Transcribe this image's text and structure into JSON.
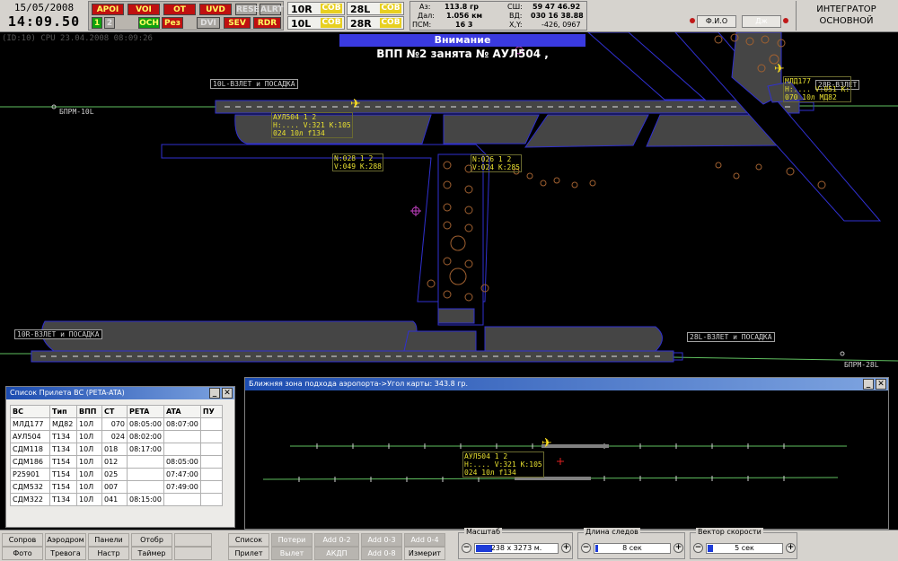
{
  "header": {
    "date": "15/05/2008",
    "time": "14:09.50",
    "cpu_line": "(ID:10) CPU 23.04.2008 08:09:26",
    "mode_buttons": [
      "APOI",
      "VOI",
      "OT",
      "UVD",
      "RESEZ",
      "ALRT",
      "1",
      "2",
      "OCH",
      "Рез",
      "DVI",
      "SEV",
      "RDR"
    ],
    "runway_status": [
      {
        "name": "10R",
        "state": "COB"
      },
      {
        "name": "10L",
        "state": "COB"
      },
      {
        "name": "28L",
        "state": "COB"
      },
      {
        "name": "28R",
        "state": "COB"
      }
    ],
    "info": {
      "az_label": "Аз:",
      "az_value": "113.8 гр",
      "dal_label": "Дал:",
      "dal_value": "1.056 км",
      "psm_label": "ПСМ:",
      "psm_value": "16 3",
      "ssh_label": "СШ:",
      "ssh_value": "59 47 46.92",
      "vd_label": "ВД:",
      "vd_value": "030 16 38.88",
      "xy_label": "X,Y:",
      "xy_value": "-426, 0967"
    },
    "fio_label": "Ф.И.О",
    "dzh_label": "Дж",
    "integrator_line1": "ИНТЕГРАТОР",
    "integrator_line2": "ОСНОВНОЙ",
    "colors": {
      "red": "#c01010",
      "green": "#10a010",
      "cob": "#e8d020"
    }
  },
  "alert": {
    "title": "Внимание",
    "message": "ВПП №2 занята №  АУЛ504 ,"
  },
  "map": {
    "labels": {
      "rwy_top": "10L-ВЗЛЕТ и ПОСАДКА",
      "rwy_bottom_left": "10R-ВЗЛЕТ и ПОСАДКА",
      "rwy_bottom_right": "28L-ВЗЛЕТ и ПОСАДКА",
      "rwy_top_right": "28R-ВЗЛЕТ",
      "bprm_10l": "БПРМ-10L",
      "bprm_28l": "БПРМ-28L"
    },
    "tags": [
      {
        "id": "aul504",
        "text": "АУЛ504 1 2\nH:.... V:321 K:105\n024 10л f134"
      },
      {
        "id": "n028",
        "text": "N:028 1 2\nV:049 K:288"
      },
      {
        "id": "n026",
        "text": "N:026 1 2\nV:024 K:285"
      },
      {
        "id": "mld177",
        "text": "МЛД177\nH:.... V:051 K:\n070 10л МД82"
      }
    ]
  },
  "flight_list": {
    "title": "Список Прилета ВС (PETA-ATA)",
    "columns": [
      "ВС",
      "Тип",
      "ВПП",
      "СТ",
      "PETA",
      "ATA",
      "ПУ"
    ],
    "rows": [
      [
        "МЛД177",
        "МД82",
        "10Л",
        "070",
        "08:05:00",
        "08:07:00",
        ""
      ],
      [
        "АУЛ504",
        "Т134",
        "10Л",
        "024",
        "08:02:00",
        "",
        ""
      ],
      [
        "СДМ118",
        "Т134",
        "10Л",
        "018",
        "08:17:00",
        "",
        ""
      ],
      [
        "СДМ186",
        "Т154",
        "10Л",
        "012",
        "",
        "08:05:00",
        ""
      ],
      [
        "Р25901",
        "Т154",
        "10Л",
        "025",
        "",
        "07:47:00",
        ""
      ],
      [
        "СДМ532",
        "Т154",
        "10Л",
        "007",
        "",
        "07:49:00",
        ""
      ],
      [
        "СДМ322",
        "Т134",
        "10Л",
        "041",
        "08:15:00",
        "",
        ""
      ]
    ]
  },
  "approach": {
    "title": "Ближняя зона подхода аэропорта->Угол карты: 343.8 гр.",
    "tag": "АУЛ504 1 2\nH:.... V:321 K:105\n024 10л f134"
  },
  "bottom": {
    "left_buttons": [
      {
        "label": "Сопров",
        "dark": false
      },
      {
        "label": "Аэродром",
        "dark": false
      },
      {
        "label": "Панели",
        "dark": false
      },
      {
        "label": "Отобр",
        "dark": false
      },
      {
        "label": "Фото",
        "dark": false
      },
      {
        "label": "Тревога",
        "dark": false
      },
      {
        "label": "Настр",
        "dark": false
      },
      {
        "label": "Таймер",
        "dark": false
      }
    ],
    "mid_buttons": [
      {
        "label": "Список",
        "dark": false
      },
      {
        "label": "Потери",
        "dark": true
      },
      {
        "label": "Add 0-2",
        "dark": true
      },
      {
        "label": "Add 0-3",
        "dark": true
      },
      {
        "label": "Add 0-4",
        "dark": true
      },
      {
        "label": "Прилет",
        "dark": false
      },
      {
        "label": "Вылет",
        "dark": true
      },
      {
        "label": "АКДП",
        "dark": true
      },
      {
        "label": "Add 0-8",
        "dark": true
      },
      {
        "label": "Измерит",
        "dark": false
      }
    ],
    "scale": {
      "title": "Масштаб",
      "value": "238 x 3273 м."
    },
    "trail": {
      "title": "Длина следов",
      "value": "8 сек"
    },
    "speed": {
      "title": "Вектор скорости",
      "value": "5 сек"
    }
  }
}
